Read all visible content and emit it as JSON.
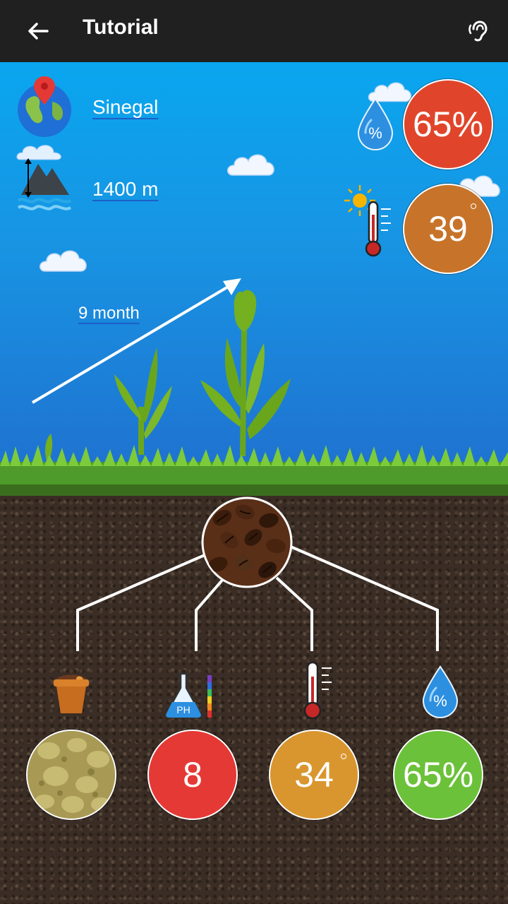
{
  "appbar": {
    "title": "Tutorial",
    "back_icon": "arrow-left-icon",
    "listen_icon": "ear-icon"
  },
  "location": {
    "name": "Sinegal",
    "icon": "globe-pin-icon"
  },
  "altitude": {
    "value": "1400 m",
    "icon": "mountain-altitude-icon"
  },
  "growth": {
    "duration": "9 month"
  },
  "air": {
    "humidity": "65%",
    "temperature": "39",
    "humidity_color": "#e0452b",
    "temperature_color": "#c7742a"
  },
  "seed": {
    "name_icon": "coffee-beans-icon"
  },
  "soil": {
    "items": [
      {
        "icon": "soil-pot-icon",
        "value": "",
        "color": "#b0a060"
      },
      {
        "icon": "ph-flask-icon",
        "value": "8",
        "color": "#e53935"
      },
      {
        "icon": "thermometer-icon",
        "value": "34",
        "color": "#d9962f"
      },
      {
        "icon": "water-drop-percent-icon",
        "value": "65%",
        "color": "#6cc13a"
      }
    ]
  }
}
